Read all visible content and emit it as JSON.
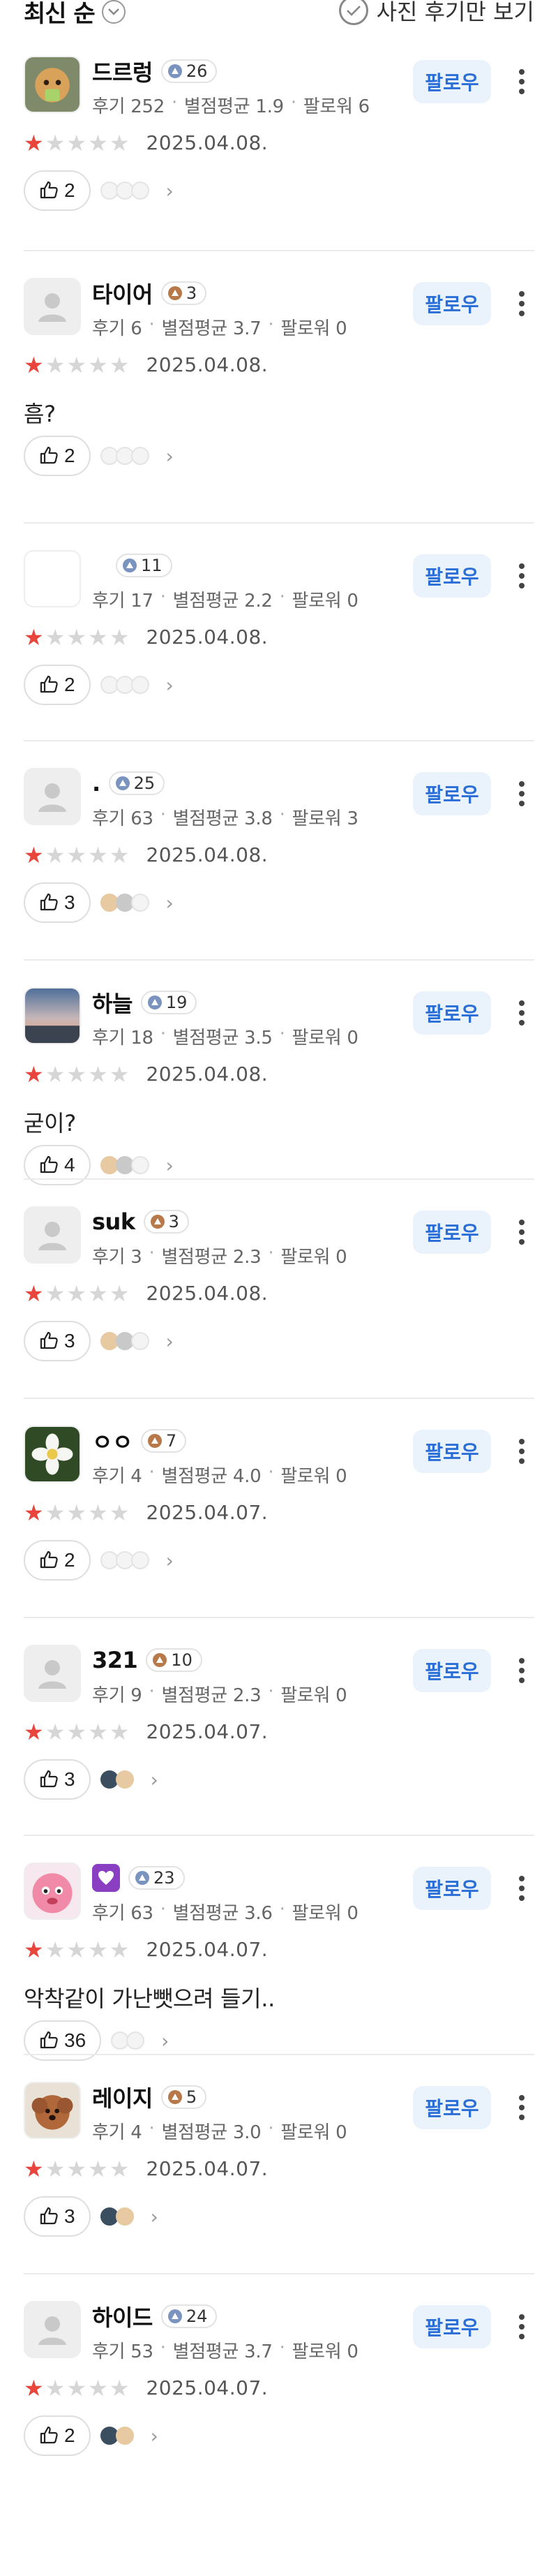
{
  "header": {
    "sort_label": "최신 순",
    "photo_only_label": "사진 후기만 보기"
  },
  "follow_label": "팔로우",
  "meta_labels": {
    "reviews": "후기",
    "avg": "별점평균",
    "followers": "팔로워"
  },
  "colors": {
    "accent": "#2b6fd6",
    "star": "#e8453c",
    "follow_bg": "#eaf2fc"
  },
  "reviews": [
    {
      "name": "드르렁",
      "badge": "26",
      "badge_tier": "blue",
      "avatar": "hamster-photo",
      "reviews": "252",
      "avg": "1.9",
      "followers": "6",
      "stars": 1,
      "date": "2025.04.08.",
      "text": "",
      "likes": "2"
    },
    {
      "name": "타이어",
      "badge": "3",
      "badge_tier": "bronze",
      "avatar": "default-user",
      "reviews": "6",
      "avg": "3.7",
      "followers": "0",
      "stars": 1,
      "date": "2025.04.08.",
      "text": "흠?",
      "likes": "2"
    },
    {
      "name": "",
      "badge": "11",
      "badge_tier": "blue",
      "avatar": "blank",
      "reviews": "17",
      "avg": "2.2",
      "followers": "0",
      "stars": 1,
      "date": "2025.04.08.",
      "text": "",
      "likes": "2"
    },
    {
      "name": ".",
      "badge": "25",
      "badge_tier": "blue",
      "avatar": "default-user",
      "reviews": "63",
      "avg": "3.8",
      "followers": "3",
      "stars": 1,
      "date": "2025.04.08.",
      "text": "",
      "likes": "3"
    },
    {
      "name": "하늘",
      "badge": "19",
      "badge_tier": "blue",
      "avatar": "sky-photo",
      "reviews": "18",
      "avg": "3.5",
      "followers": "0",
      "stars": 1,
      "date": "2025.04.08.",
      "text": "굳이?",
      "likes": "4"
    },
    {
      "name": "suk",
      "badge": "3",
      "badge_tier": "bronze",
      "avatar": "default-user",
      "reviews": "3",
      "avg": "2.3",
      "followers": "0",
      "stars": 1,
      "date": "2025.04.08.",
      "text": "",
      "likes": "3"
    },
    {
      "name": "ㅇㅇ",
      "badge": "7",
      "badge_tier": "bronze",
      "avatar": "flower-photo",
      "reviews": "4",
      "avg": "4.0",
      "followers": "0",
      "stars": 1,
      "date": "2025.04.07.",
      "text": "",
      "likes": "2"
    },
    {
      "name": "321",
      "badge": "10",
      "badge_tier": "bronze",
      "avatar": "default-user",
      "reviews": "9",
      "avg": "2.3",
      "followers": "0",
      "stars": 1,
      "date": "2025.04.07.",
      "text": "",
      "likes": "3"
    },
    {
      "name": "",
      "badge": "23",
      "badge_tier": "blue",
      "avatar": "pink-character",
      "emoji": "purple-heart-icon",
      "reviews": "63",
      "avg": "3.6",
      "followers": "0",
      "stars": 1,
      "date": "2025.04.07.",
      "text": "악착같이 가난뺏으려 들기..",
      "likes": "36"
    },
    {
      "name": "레이지",
      "badge": "5",
      "badge_tier": "bronze",
      "avatar": "dog-photo",
      "reviews": "4",
      "avg": "3.0",
      "followers": "0",
      "stars": 1,
      "date": "2025.04.07.",
      "text": "",
      "likes": "3"
    },
    {
      "name": "하이드",
      "badge": "24",
      "badge_tier": "blue",
      "avatar": "default-user",
      "reviews": "53",
      "avg": "3.7",
      "followers": "0",
      "stars": 1,
      "date": "2025.04.07.",
      "text": "",
      "likes": "2"
    }
  ]
}
